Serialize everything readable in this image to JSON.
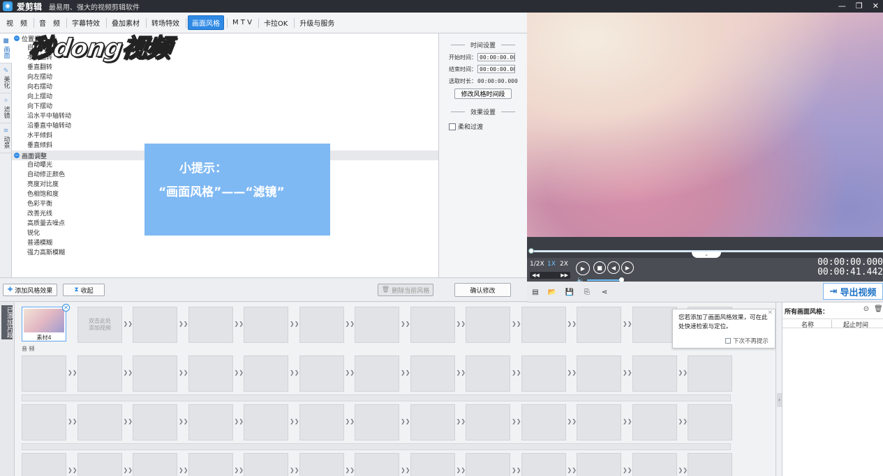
{
  "app": {
    "title": "爱剪辑",
    "slogan": "最易用、强大的视频剪辑软件",
    "logo_glyph": "◉"
  },
  "window_buttons": {
    "minimize": "—",
    "restore": "❐",
    "close": "✕"
  },
  "menu": [
    {
      "label": "视　频",
      "active": false
    },
    {
      "label": "音　频",
      "active": false
    },
    {
      "label": "字幕特效",
      "active": false
    },
    {
      "label": "叠加素材",
      "active": false
    },
    {
      "label": "转场特效",
      "active": false
    },
    {
      "label": "画面风格",
      "active": true
    },
    {
      "label": "M T V",
      "active": false
    },
    {
      "label": "卡拉OK",
      "active": false
    },
    {
      "label": "升级与服务",
      "active": false
    }
  ],
  "left_tabs": [
    {
      "label": "画面",
      "icon": "square-icon",
      "glyph": "■"
    },
    {
      "label": "美化",
      "icon": "wand-icon",
      "glyph": "✎"
    },
    {
      "label": "滤镜",
      "icon": "sparkle-icon",
      "glyph": "✧"
    },
    {
      "label": "动景",
      "icon": "wave-icon",
      "glyph": "≋"
    }
  ],
  "watermark": "秒dong视频",
  "effect_groups": [
    {
      "name": "位置调整",
      "items": [
        "自由旋转",
        "水平翻转",
        "垂直翻转",
        "向左摆动",
        "向右摆动",
        "向上摆动",
        "向下摆动",
        "沿水平中轴转动",
        "沿垂直中轴转动",
        "水平倾斜",
        "垂直倾斜"
      ]
    },
    {
      "name": "画面调整",
      "items": [
        "自动曝光",
        "自动修正颜色",
        "亮度对比度",
        "色相饱和度",
        "色彩平衡",
        "改善光线",
        "高质量去噪点",
        "锐化",
        "普通模糊",
        "强力高斯模糊"
      ]
    }
  ],
  "tip": {
    "line1": "小提示：",
    "line2": "“画面风格”——“滤镜”"
  },
  "settings": {
    "time_title": "时间设置",
    "start_label": "开始时间：",
    "start_value": "00:00:00.000",
    "end_label": "结束时间：",
    "end_value": "00:00:00.000",
    "duration_label": "选取时长：",
    "duration_value": "00:00:00.000",
    "modify_time_button": "修改风格时间段",
    "effect_title": "效果设置",
    "soft_transition": "柔和过渡"
  },
  "actions": {
    "add_effect": "添加风格效果",
    "collapse": "收起",
    "delete_current": "删除当前风格",
    "confirm": "确认修改"
  },
  "player": {
    "speeds": [
      "1/2X",
      "1X",
      "2X"
    ],
    "current_time": "00:00:00.000",
    "total_time": "00:00:41.442",
    "volume_fraction": 0.9,
    "progress_fraction": 0.0
  },
  "export_button": "导出视频",
  "timeline": {
    "side_label": "已添加片段",
    "first_clip_label": "素材4",
    "add_hint": "双击此处\n添加视频",
    "audio_label": "音 频",
    "popup_message": "您若添加了画面风格效果，可在此处快速检索与定位。",
    "popup_no_more": "下次不再提示"
  },
  "right_panel": {
    "title": "所有画面风格：",
    "col_name": "名称",
    "col_time": "起止时间"
  },
  "colors": {
    "accent": "#2f8ae5",
    "tip_bg": "#7fb9f4",
    "titlebar": "#2a2d34"
  }
}
